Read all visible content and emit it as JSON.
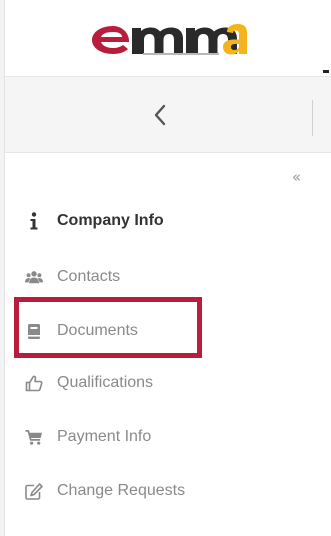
{
  "app": {
    "logo_alt_text": "emma"
  },
  "header": {
    "back_icon": "chevron-left-icon",
    "collapse_icon_text": "«"
  },
  "sidebar": {
    "items": [
      {
        "label": "Company Info",
        "icon": "info-icon",
        "active": true
      },
      {
        "label": "Contacts",
        "icon": "users-icon",
        "active": false
      },
      {
        "label": "Documents",
        "icon": "book-icon",
        "active": false,
        "highlighted": true
      },
      {
        "label": "Qualifications",
        "icon": "thumbs-up-icon",
        "active": false
      },
      {
        "label": "Payment Info",
        "icon": "cart-icon",
        "active": false
      },
      {
        "label": "Change Requests",
        "icon": "edit-icon",
        "active": false
      }
    ]
  },
  "colors": {
    "brand_red": "#b81e3c",
    "brand_yellow": "#f3b51b",
    "logo_dark": "#2a2a2a",
    "text_muted": "#8a8a8a",
    "text_active": "#333333"
  }
}
